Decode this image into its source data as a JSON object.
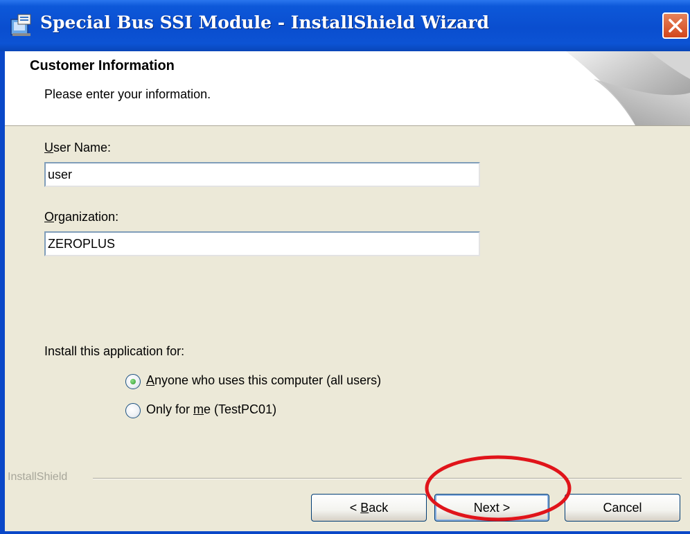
{
  "window": {
    "title": "Special Bus SSI Module - InstallShield Wizard",
    "icon": "installer-icon",
    "close_icon": "close-icon"
  },
  "banner": {
    "title": "Customer Information",
    "subtitle": "Please enter your information."
  },
  "form": {
    "user_name_label_u": "U",
    "user_name_label_rest": "ser Name:",
    "user_name_value": "user",
    "organization_label_u": "O",
    "organization_label_rest": "rganization:",
    "organization_value": "ZEROPLUS",
    "install_for_label": "Install this application for:",
    "options": [
      {
        "u": "A",
        "rest": "nyone who uses this computer (all users)",
        "selected": true
      },
      {
        "pre": "Only for ",
        "u": "m",
        "rest": "e (TestPC01)",
        "selected": false
      }
    ]
  },
  "footer": {
    "brand": "InstallShield",
    "back_prefix": "< ",
    "back_u": "B",
    "back_rest": "ack",
    "next_label": "Next >",
    "cancel_label": "Cancel"
  },
  "colors": {
    "titlebar": "#0a4ecf",
    "dialog_bg": "#ece9d8",
    "annotation": "#e0141a"
  }
}
